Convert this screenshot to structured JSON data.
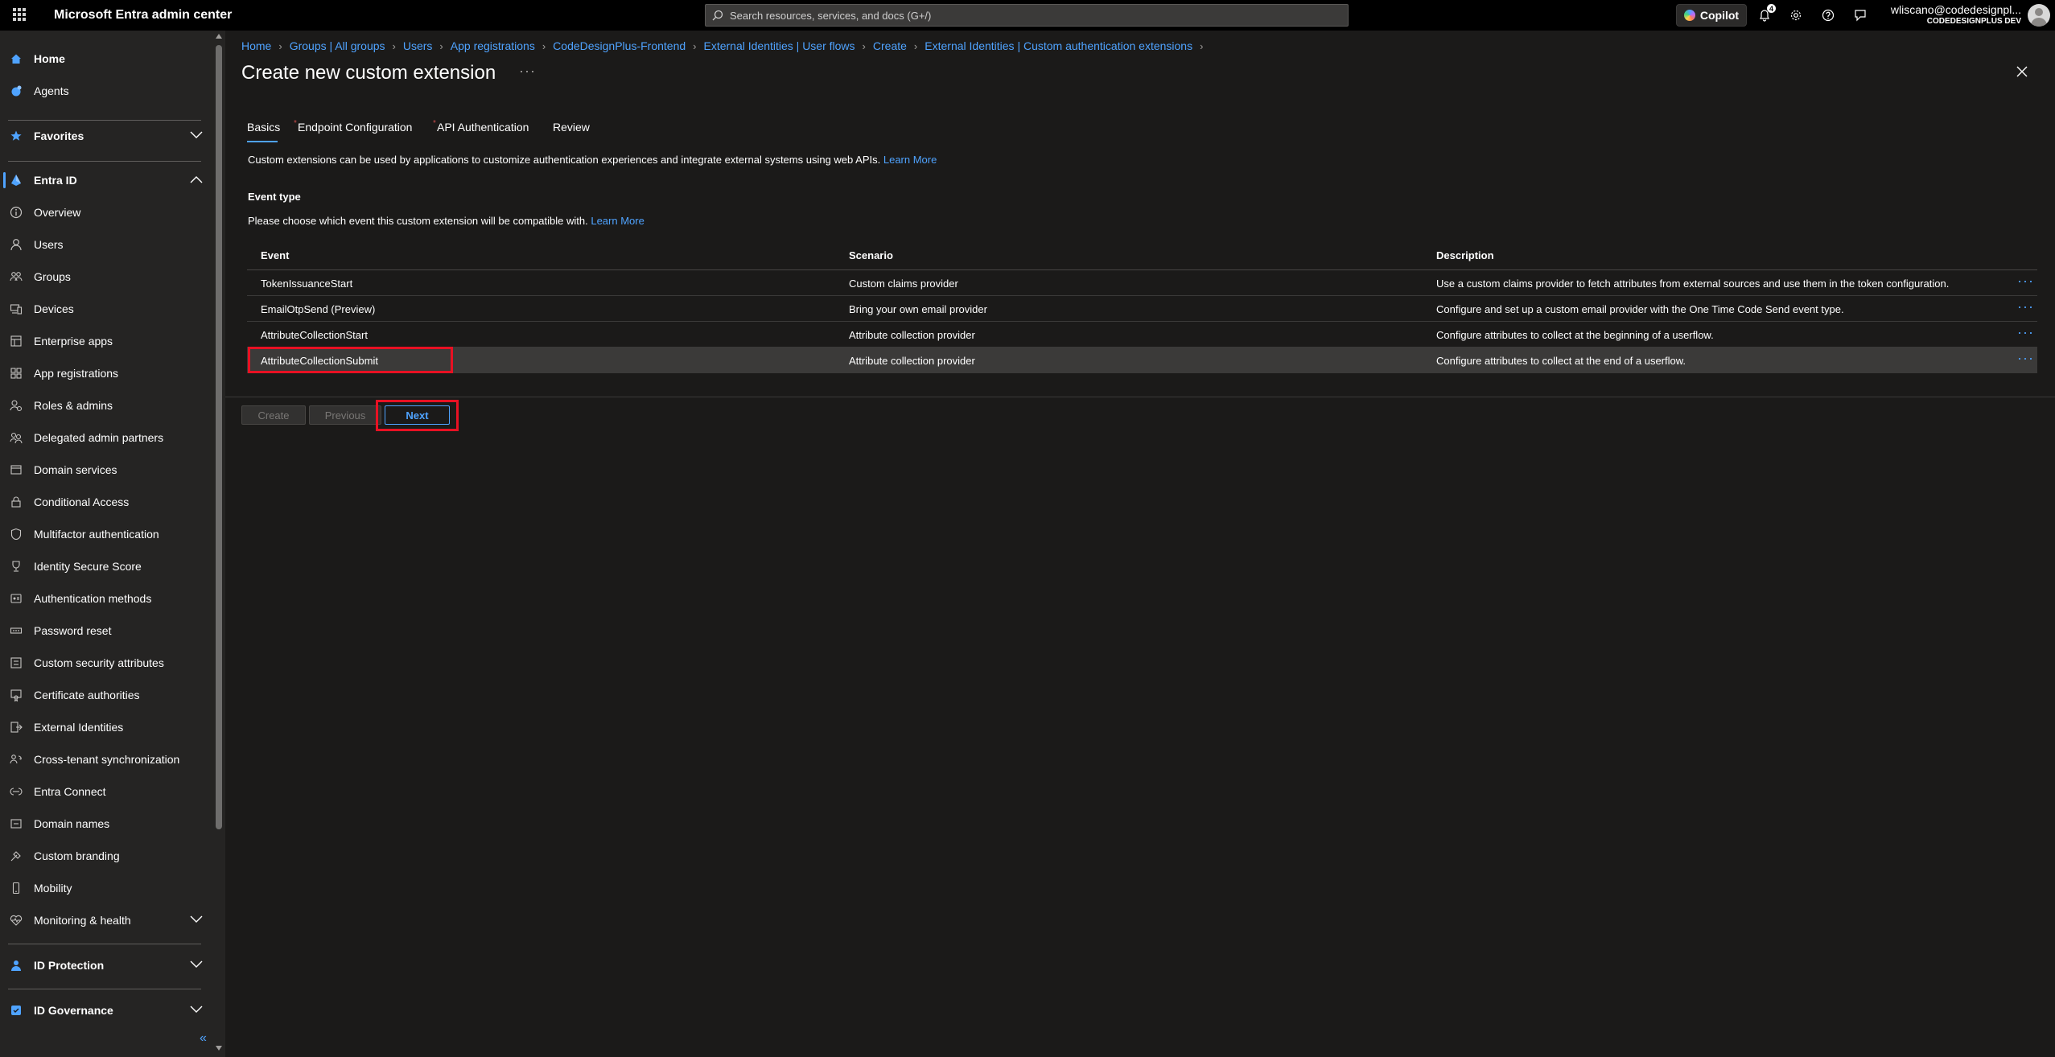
{
  "app": {
    "title": "Microsoft Entra admin center"
  },
  "search": {
    "placeholder": "Search resources, services, and docs (G+/)"
  },
  "topbar": {
    "copilot_label": "Copilot",
    "notification_count": "4",
    "user": "wliscano@codedesignpl...",
    "tenant": "CODEDESIGNPLUS DEV",
    "icons": [
      "waffle-icon",
      "bell-icon",
      "gear-icon",
      "help-icon",
      "feedback-icon"
    ]
  },
  "sidebar": {
    "items": [
      {
        "label": "Home",
        "icon": "home-icon",
        "bold": true
      },
      {
        "label": "Agents",
        "icon": "agents-icon"
      },
      {
        "label": "Favorites",
        "icon": "star-icon",
        "bold": true,
        "expandable": true
      },
      {
        "label": "Entra ID",
        "icon": "entra-icon",
        "bold": true,
        "expanded": true
      },
      {
        "label": "Overview",
        "icon": "info-icon"
      },
      {
        "label": "Users",
        "icon": "user-icon"
      },
      {
        "label": "Groups",
        "icon": "groups-icon"
      },
      {
        "label": "Devices",
        "icon": "devices-icon"
      },
      {
        "label": "Enterprise apps",
        "icon": "enterprise-apps-icon"
      },
      {
        "label": "App registrations",
        "icon": "app-registrations-icon"
      },
      {
        "label": "Roles & admins",
        "icon": "roles-icon"
      },
      {
        "label": "Delegated admin partners",
        "icon": "partners-icon"
      },
      {
        "label": "Domain services",
        "icon": "domain-services-icon"
      },
      {
        "label": "Conditional Access",
        "icon": "conditional-access-icon"
      },
      {
        "label": "Multifactor authentication",
        "icon": "mfa-icon"
      },
      {
        "label": "Identity Secure Score",
        "icon": "trophy-icon"
      },
      {
        "label": "Authentication methods",
        "icon": "auth-methods-icon"
      },
      {
        "label": "Password reset",
        "icon": "password-reset-icon"
      },
      {
        "label": "Custom security attributes",
        "icon": "custom-attributes-icon"
      },
      {
        "label": "Certificate authorities",
        "icon": "certificate-icon"
      },
      {
        "label": "External Identities",
        "icon": "external-identities-icon"
      },
      {
        "label": "Cross-tenant synchronization",
        "icon": "sync-icon"
      },
      {
        "label": "Entra Connect",
        "icon": "connect-icon"
      },
      {
        "label": "Domain names",
        "icon": "domain-names-icon"
      },
      {
        "label": "Custom branding",
        "icon": "branding-icon"
      },
      {
        "label": "Mobility",
        "icon": "mobility-icon"
      },
      {
        "label": "Monitoring & health",
        "icon": "monitoring-icon",
        "expandable": true
      },
      {
        "label": "ID Protection",
        "icon": "id-protection-icon",
        "bold": true,
        "expandable": true
      },
      {
        "label": "ID Governance",
        "icon": "id-governance-icon",
        "bold": true,
        "expandable": true
      }
    ]
  },
  "breadcrumb": [
    "Home",
    "Groups | All groups",
    "Users",
    "App registrations",
    "CodeDesignPlus-Frontend",
    "External Identities | User flows",
    "Create",
    "External Identities | Custom authentication extensions"
  ],
  "page": {
    "title": "Create new custom extension",
    "more": "···"
  },
  "tabs": [
    "Basics",
    "Endpoint Configuration",
    "API Authentication",
    "Review"
  ],
  "intro": {
    "text": "Custom extensions can be used by applications to customize authentication experiences and integrate external systems using web APIs.",
    "link": "Learn More"
  },
  "event_type": {
    "heading": "Event type",
    "hint": "Please choose which event this custom extension will be compatible with.",
    "hint_link": "Learn More"
  },
  "table": {
    "columns": [
      "Event",
      "Scenario",
      "Description"
    ],
    "rows": [
      {
        "event": "TokenIssuanceStart",
        "scenario": "Custom claims provider",
        "description": "Use a custom claims provider to fetch attributes from external sources and use them in the token configuration."
      },
      {
        "event": "EmailOtpSend (Preview)",
        "scenario": "Bring your own email provider",
        "description": "Configure and set up a custom email provider with the One Time Code Send event type."
      },
      {
        "event": "AttributeCollectionStart",
        "scenario": "Attribute collection provider",
        "description": "Configure attributes to collect at the beginning of a userflow."
      },
      {
        "event": "AttributeCollectionSubmit",
        "scenario": "Attribute collection provider",
        "description": "Configure attributes to collect at the end of a userflow.",
        "selected": true
      }
    ],
    "row_action": "···"
  },
  "buttons": {
    "create": "Create",
    "previous": "Previous",
    "next": "Next"
  },
  "colors": {
    "accent": "#4fa3ff",
    "highlight": "#e81123",
    "background": "#1b1a19",
    "sidebar": "#252423"
  }
}
